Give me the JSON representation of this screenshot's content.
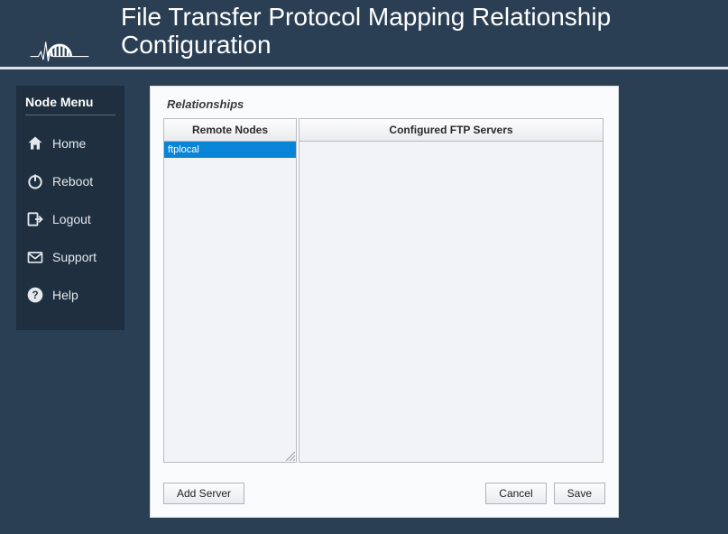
{
  "header": {
    "title": "File Transfer Protocol Mapping Relationship Configuration"
  },
  "sidebar": {
    "title": "Node Menu",
    "items": [
      {
        "label": "Home"
      },
      {
        "label": "Reboot"
      },
      {
        "label": "Logout"
      },
      {
        "label": "Support"
      },
      {
        "label": "Help"
      }
    ]
  },
  "panel": {
    "title": "Relationships",
    "remote_header": "Remote Nodes",
    "servers_header": "Configured FTP Servers",
    "remote_nodes": [
      {
        "name": "ftplocal"
      }
    ],
    "buttons": {
      "add": "Add Server",
      "cancel": "Cancel",
      "save": "Save"
    }
  }
}
